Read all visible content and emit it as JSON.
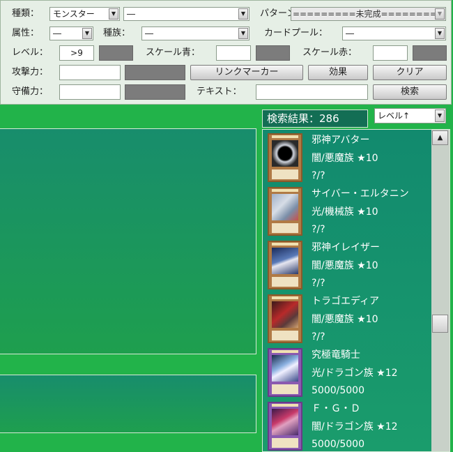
{
  "filters": {
    "kind_label": "種類：",
    "kind_value": "モンスター",
    "subkind_value": "―",
    "pattern_label": "パターン：",
    "pattern_value": "=========未完成=========",
    "attribute_label": "属性：",
    "attribute_value": "―",
    "race_label": "種族：",
    "race_value": "―",
    "pool_label": "カードプール：",
    "pool_value": "―",
    "level_label": "レベル：",
    "level_value": ">9",
    "scale_blue_label": "スケール青：",
    "scale_red_label": "スケール赤：",
    "atk_label": "攻撃力：",
    "def_label": "守備力：",
    "text_label": "テキスト：",
    "link_marker_button": "リンクマーカー",
    "effect_button": "効果",
    "clear_button": "クリア",
    "search_button": "検索"
  },
  "results": {
    "count_text": "検索結果：286",
    "sort_value": "レベル↑"
  },
  "cards": [
    {
      "name": "邪神アバター",
      "meta": "闇/悪魔族 ★10",
      "stats": "?/?"
    },
    {
      "name": "サイバー・エルタニン",
      "meta": "光/機械族 ★10",
      "stats": "?/?"
    },
    {
      "name": "邪神イレイザー",
      "meta": "闇/悪魔族 ★10",
      "stats": "?/?"
    },
    {
      "name": "トラゴエディア",
      "meta": "闇/悪魔族 ★10",
      "stats": "?/?"
    },
    {
      "name": "究極竜騎士",
      "meta": "光/ドラゴン族 ★12",
      "stats": "5000/5000"
    },
    {
      "name": "Ｆ・Ｇ・Ｄ",
      "meta": "闇/ドラゴン族 ★12",
      "stats": "5000/5000"
    }
  ],
  "icons": {
    "dropdown": "chevron-down-icon",
    "scroll_up": "chevron-up-icon"
  },
  "colors": {
    "background": "#22b34a",
    "panel": "#e6efe6",
    "list_bg": "#128a6e"
  }
}
